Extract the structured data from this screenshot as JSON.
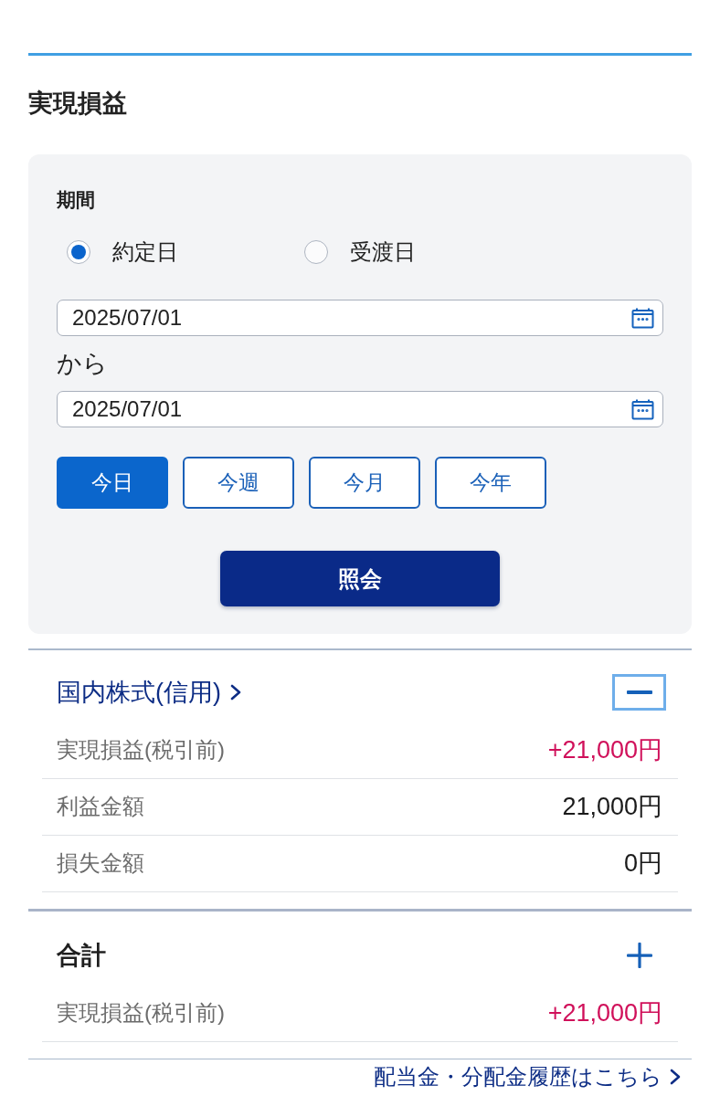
{
  "title": "実現損益",
  "filter_panel": {
    "period_label": "期間",
    "date_type_options": [
      {
        "label": "約定日",
        "selected": true
      },
      {
        "label": "受渡日",
        "selected": false
      }
    ],
    "start_date": {
      "value": "2025/07/01"
    },
    "range_separator": "から",
    "end_date": {
      "value": "2025/07/01"
    },
    "quick_ranges": [
      {
        "label": "今日",
        "selected": true
      },
      {
        "label": "今週",
        "selected": false
      },
      {
        "label": "今月",
        "selected": false
      },
      {
        "label": "今年",
        "selected": false
      }
    ],
    "submit_button": "照会"
  },
  "sections": [
    {
      "title": "国内株式(信用)",
      "kind": "link",
      "expanded": true,
      "focused": true,
      "rows": [
        {
          "label": "実現損益(税引前)",
          "value": "+21,000円",
          "kind": "gain"
        },
        {
          "label": "利益金額",
          "value": "21,000円",
          "kind": "amount"
        },
        {
          "label": "損失金額",
          "value": "0円",
          "kind": "amount"
        }
      ]
    },
    {
      "title": "合計",
      "kind": "heading",
      "expanded": false,
      "focused": false,
      "rows": [
        {
          "label": "実現損益(税引前)",
          "value": "+21,000円",
          "kind": "gain"
        }
      ]
    }
  ],
  "footer_link": "配当金・分配金履歴はこちら"
}
